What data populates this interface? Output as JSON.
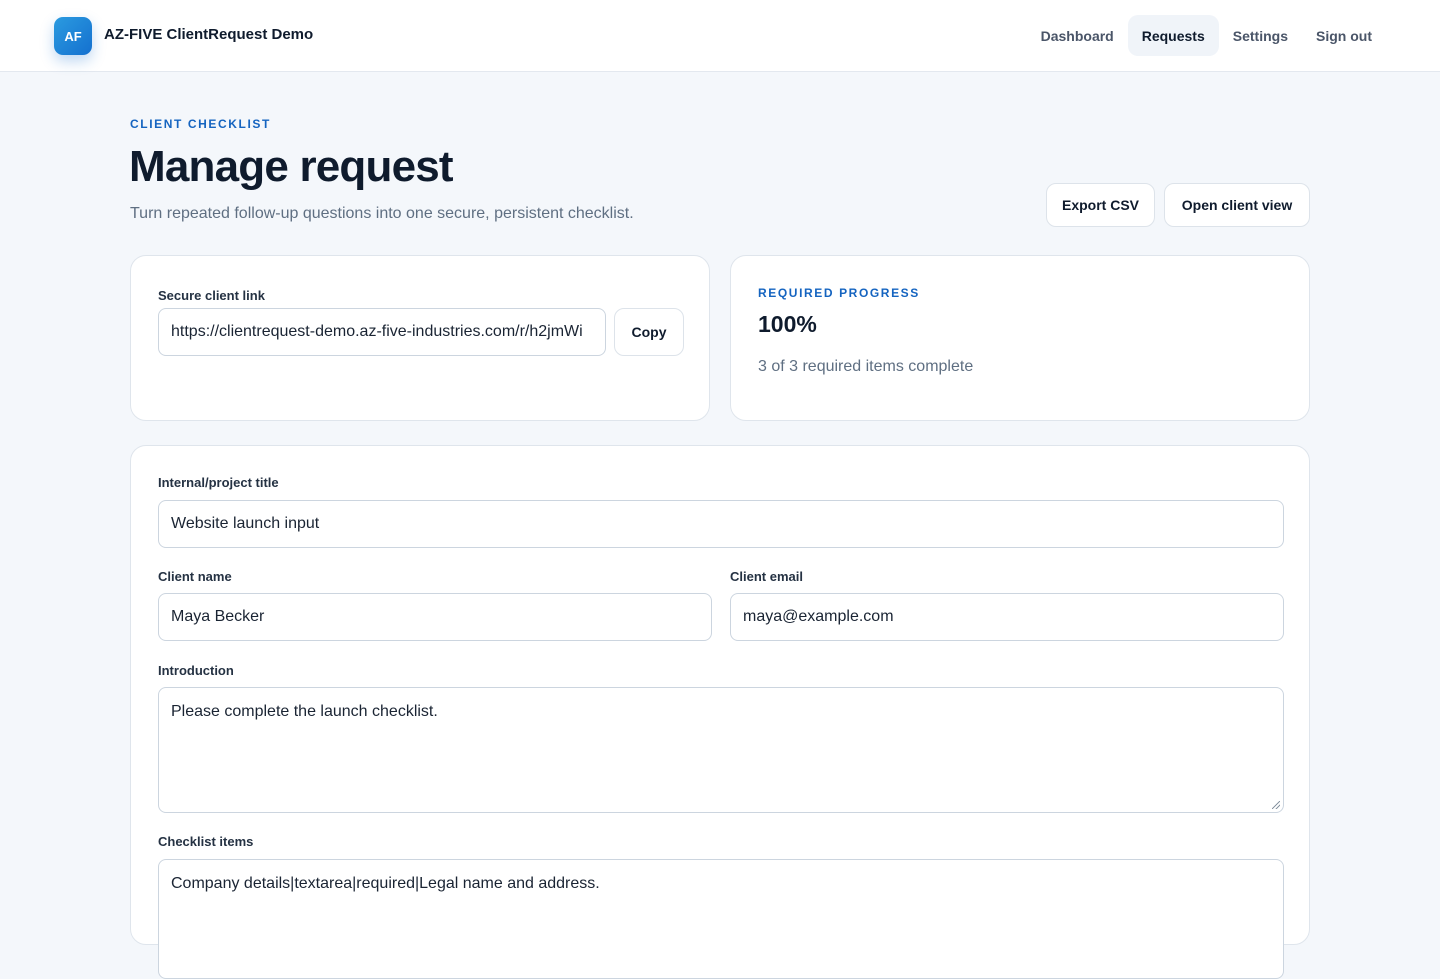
{
  "app": {
    "logo_text": "AF",
    "brand": "AZ-FIVE ClientRequest Demo"
  },
  "nav": {
    "items": [
      {
        "label": "Dashboard",
        "active": false
      },
      {
        "label": "Requests",
        "active": true
      },
      {
        "label": "Settings",
        "active": false
      },
      {
        "label": "Sign out",
        "active": false
      }
    ]
  },
  "header": {
    "eyebrow": "CLIENT CHECKLIST",
    "title": "Manage request",
    "subtitle": "Turn repeated follow-up questions into one secure, persistent checklist.",
    "export_label": "Export CSV",
    "open_client_label": "Open client view"
  },
  "link_card": {
    "label": "Secure client link",
    "url": "https://clientrequest-demo.az-five-industries.com/r/h2jmWi",
    "copy_label": "Copy"
  },
  "progress_card": {
    "eyebrow": "REQUIRED PROGRESS",
    "percent_text": "100%",
    "progress_fraction": 1.0,
    "summary": "3 of 3 required items complete"
  },
  "form": {
    "title_label": "Internal/project title",
    "title_value": "Website launch input",
    "client_name_label": "Client name",
    "client_name_value": "Maya Becker",
    "client_email_label": "Client email",
    "client_email_value": "maya@example.com",
    "intro_label": "Introduction",
    "intro_value": "Please complete the launch checklist.",
    "checklist_label": "Checklist items",
    "checklist_value": "Company details|textarea|required|Legal name and address."
  },
  "colors": {
    "accent": "#1564c0",
    "background": "#f4f7fb",
    "logo_gradient_start": "#2b9be0",
    "logo_gradient_end": "#1470cf"
  }
}
